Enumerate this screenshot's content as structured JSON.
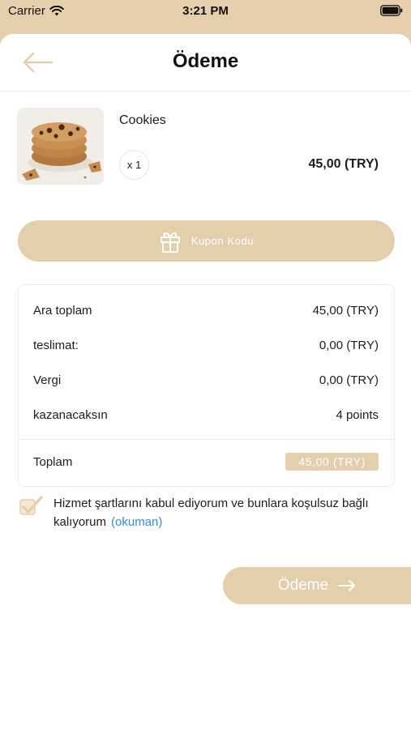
{
  "status_bar": {
    "carrier": "Carrier",
    "time": "3:21 PM",
    "icons": [
      "wifi-icon",
      "battery-icon"
    ]
  },
  "header": {
    "title": "Ödeme",
    "back_icon": "arrow-left-icon"
  },
  "product": {
    "name": "Cookies",
    "quantity": "x 1",
    "price": "45,00 (TRY)",
    "image": "cookies-photo"
  },
  "coupon": {
    "label": "Kupon Kodu",
    "icon": "gift-icon"
  },
  "summary": {
    "rows": [
      {
        "label": "Ara toplam",
        "value": "45,00 (TRY)"
      },
      {
        "label": "teslimat:",
        "value": "0,00 (TRY)"
      },
      {
        "label": "Vergi",
        "value": "0,00 (TRY)"
      },
      {
        "label": "kazanacaksın",
        "value": "4 points"
      }
    ],
    "total_label": "Toplam",
    "total_value": "45,00 (TRY)"
  },
  "terms": {
    "checked": true,
    "text": "Hizmet şartlarını kabul ediyorum ve bunlara koşulsuz bağlı kalıyorum",
    "link": "(okuman)"
  },
  "pay_button": {
    "label": "Ödeme",
    "icon": "arrow-right-icon"
  },
  "colors": {
    "accent": "#e4cfad",
    "link": "#2c8ee8",
    "background": "#ffffff",
    "top_bar": "#e6cfad"
  }
}
